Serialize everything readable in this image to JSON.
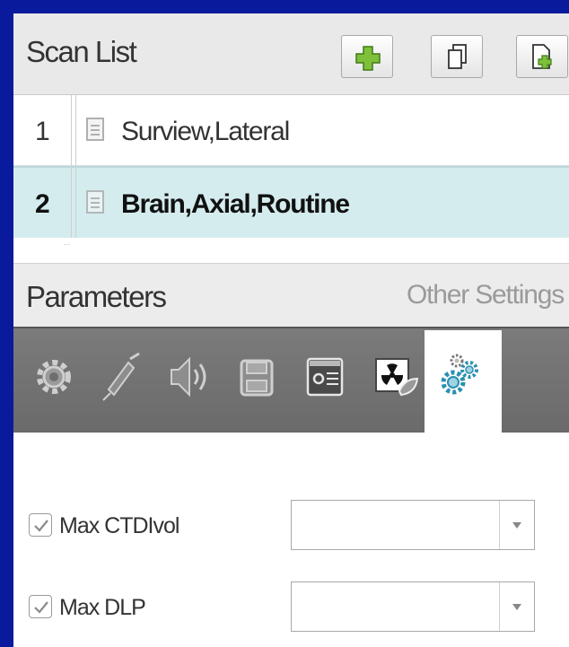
{
  "scan_list": {
    "title": "Scan List",
    "toolbar": [
      {
        "name": "add-scan-button",
        "icon": "plus-icon"
      },
      {
        "name": "copy-scan-button",
        "icon": "copy-icon"
      },
      {
        "name": "append-scan-button",
        "icon": "document-add-icon"
      }
    ],
    "rows": [
      {
        "number": "1",
        "name": "Surview,Lateral",
        "icon": "clipboard-icon",
        "selected": false
      },
      {
        "number": "2",
        "name": "Brain,Axial,Routine",
        "icon": "clipboard-icon",
        "selected": true
      }
    ]
  },
  "parameters": {
    "title": "Parameters",
    "other_settings": "Other Settings",
    "tabs": [
      {
        "name": "gear-icon",
        "active": false
      },
      {
        "name": "syringe-icon",
        "active": false
      },
      {
        "name": "speaker-icon",
        "active": false
      },
      {
        "name": "save-disk-icon",
        "active": false
      },
      {
        "name": "settings-panel-icon",
        "active": false
      },
      {
        "name": "radiation-dose-icon",
        "active": false
      },
      {
        "name": "multi-gear-icon",
        "active": true
      }
    ]
  },
  "form": {
    "fields": [
      {
        "label": "Max CTDIvol",
        "checked": true,
        "value": ""
      },
      {
        "label": "Max DLP",
        "checked": true,
        "value": ""
      }
    ]
  },
  "colors": {
    "background_border": "#0a1a9c",
    "selected_row": "#d5ecee",
    "tab_bar": "#727272",
    "accent_green": "#7ec03a"
  }
}
